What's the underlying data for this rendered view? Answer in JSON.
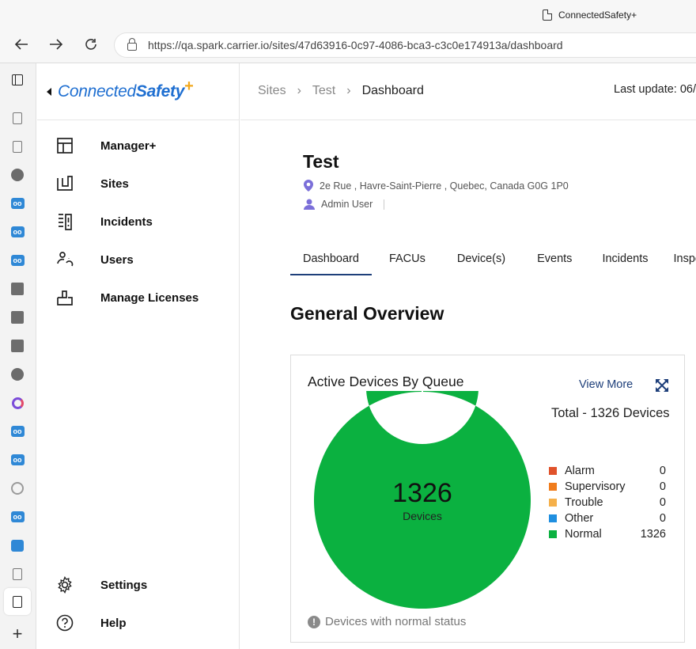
{
  "browser": {
    "tab_title": "ConnectedSafety+",
    "url": "https://qa.spark.carrier.io/sites/47d63916-0c97-4086-bca3-c3c0e174913a/dashboard",
    "back_icon": "arrow-left-icon",
    "forward_icon": "arrow-right-icon",
    "reload_icon": "reload-icon",
    "lock_icon": "lock-icon",
    "new_tab": "+"
  },
  "logo": {
    "part1": "Connected",
    "part2": "Safety",
    "plus": "+"
  },
  "sidebar": {
    "items": [
      {
        "label": "Manager+",
        "icon": "dashboard-layout-icon"
      },
      {
        "label": "Sites",
        "icon": "sites-icon"
      },
      {
        "label": "Incidents",
        "icon": "incidents-icon"
      },
      {
        "label": "Users",
        "icon": "users-icon"
      },
      {
        "label": "Manage Licenses",
        "icon": "licenses-icon"
      }
    ],
    "bottom": [
      {
        "label": "Settings",
        "icon": "gear-icon"
      },
      {
        "label": "Help",
        "icon": "help-icon"
      }
    ]
  },
  "breadcrumb": {
    "items": [
      "Sites",
      "Test"
    ],
    "current": "Dashboard",
    "separator": "›"
  },
  "last_update": "Last update: 06/",
  "site": {
    "title": "Test",
    "address": "2e Rue , Havre-Saint-Pierre , Quebec, Canada G0G 1P0",
    "user": "Admin User"
  },
  "tabs": [
    {
      "label": "Dashboard",
      "active": true
    },
    {
      "label": "FACUs",
      "active": false
    },
    {
      "label": "Device(s)",
      "active": false
    },
    {
      "label": "Events",
      "active": false
    },
    {
      "label": "Incidents",
      "active": false
    },
    {
      "label": "Inspe",
      "active": false
    }
  ],
  "section_title": "General Overview",
  "card": {
    "title": "Active Devices By Queue",
    "view_more": "View More",
    "total": "Total - 1326 Devices",
    "center_value": "1326",
    "center_label": "Devices",
    "footer": "Devices with normal status",
    "legend": [
      {
        "name": "Alarm",
        "value": "0",
        "color": "#e0522b"
      },
      {
        "name": "Supervisory",
        "value": "0",
        "color": "#f07c1c"
      },
      {
        "name": "Trouble",
        "value": "0",
        "color": "#f5b04a"
      },
      {
        "name": "Other",
        "value": "0",
        "color": "#1f8fe0"
      },
      {
        "name": "Normal",
        "value": "1326",
        "color": "#0bb140"
      }
    ]
  },
  "chart_data": {
    "type": "pie",
    "categories": [
      "Alarm",
      "Supervisory",
      "Trouble",
      "Other",
      "Normal"
    ],
    "values": [
      0,
      0,
      0,
      0,
      1326
    ],
    "title": "Active Devices By Queue",
    "donut": true
  }
}
